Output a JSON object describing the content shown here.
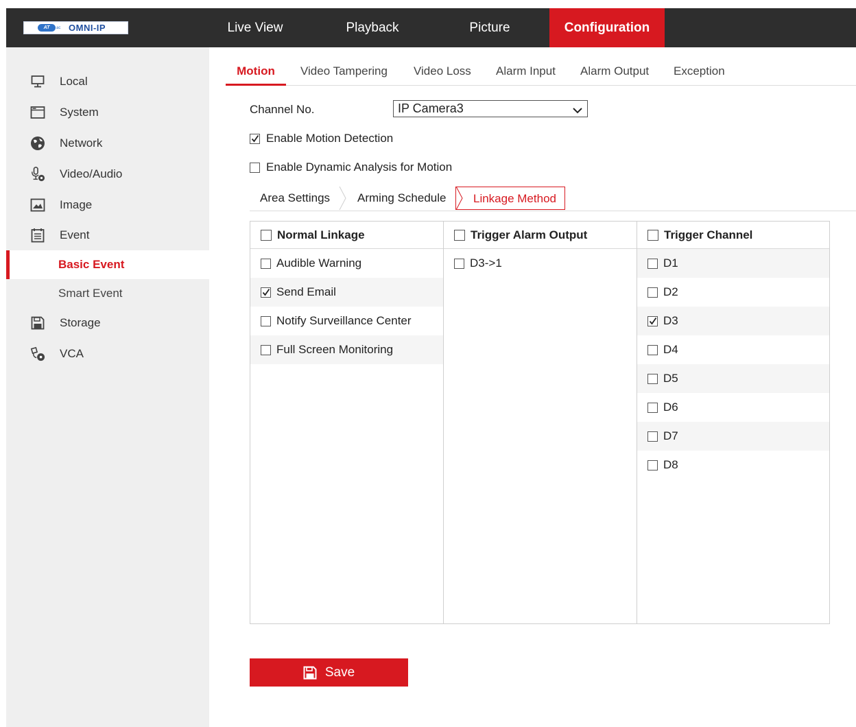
{
  "header": {
    "logo_badge": "AT",
    "logo_small": "ac",
    "logo_text": "OMNI-IP",
    "nav": [
      {
        "label": "Live View"
      },
      {
        "label": "Playback"
      },
      {
        "label": "Picture"
      },
      {
        "label": "Configuration",
        "active": true
      }
    ]
  },
  "sidebar": {
    "items": [
      {
        "label": "Local",
        "icon": "monitor-icon"
      },
      {
        "label": "System",
        "icon": "window-icon"
      },
      {
        "label": "Network",
        "icon": "globe-icon"
      },
      {
        "label": "Video/Audio",
        "icon": "mic-gear-icon"
      },
      {
        "label": "Image",
        "icon": "image-icon"
      },
      {
        "label": "Event",
        "icon": "calendar-icon"
      },
      {
        "label": "Storage",
        "icon": "save-disk-icon"
      },
      {
        "label": "VCA",
        "icon": "camera-gear-icon"
      }
    ],
    "sub_items": [
      {
        "label": "Basic Event",
        "active": true
      },
      {
        "label": "Smart Event"
      }
    ]
  },
  "tabs": [
    {
      "label": "Motion",
      "active": true
    },
    {
      "label": "Video Tampering"
    },
    {
      "label": "Video Loss"
    },
    {
      "label": "Alarm Input"
    },
    {
      "label": "Alarm Output"
    },
    {
      "label": "Exception"
    }
  ],
  "form": {
    "channel_label": "Channel No.",
    "channel_value": "IP Camera3",
    "enable_motion_label": "Enable Motion Detection",
    "enable_motion_checked": true,
    "enable_dynamic_label": "Enable Dynamic Analysis for Motion",
    "enable_dynamic_checked": false
  },
  "subtabs": [
    {
      "label": "Area Settings"
    },
    {
      "label": "Arming Schedule"
    },
    {
      "label": "Linkage Method",
      "active": true
    }
  ],
  "linkage": {
    "normal": {
      "header": "Normal Linkage",
      "items": [
        {
          "label": "Audible Warning",
          "checked": false
        },
        {
          "label": "Send Email",
          "checked": true
        },
        {
          "label": "Notify Surveillance Center",
          "checked": false
        },
        {
          "label": "Full Screen Monitoring",
          "checked": false
        }
      ]
    },
    "alarm_output": {
      "header": "Trigger Alarm Output",
      "items": [
        {
          "label": "D3->1",
          "checked": false
        }
      ]
    },
    "channel": {
      "header": "Trigger Channel",
      "items": [
        {
          "label": "D1",
          "checked": false
        },
        {
          "label": "D2",
          "checked": false
        },
        {
          "label": "D3",
          "checked": true
        },
        {
          "label": "D4",
          "checked": false
        },
        {
          "label": "D5",
          "checked": false
        },
        {
          "label": "D6",
          "checked": false
        },
        {
          "label": "D7",
          "checked": false
        },
        {
          "label": "D8",
          "checked": false
        }
      ]
    }
  },
  "save_label": "Save",
  "colors": {
    "accent": "#d71920",
    "topbar": "#2e2e2e",
    "sidebar": "#efefef"
  }
}
